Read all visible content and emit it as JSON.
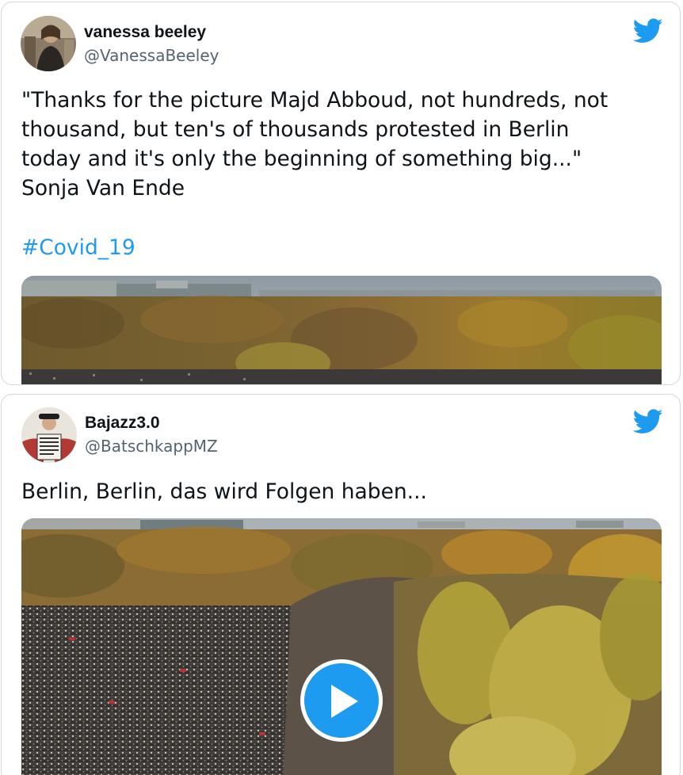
{
  "tweets": [
    {
      "name": "vanessa beeley",
      "handle": "@VanessaBeeley",
      "text_lines": [
        "\"Thanks for the picture Majd Abboud, not hundreds, not",
        "thousand, but ten's of thousands protested in Berlin",
        "today and it's only the beginning of something big...\"",
        "Sonja Van Ende"
      ],
      "hashtag": "#Covid_19",
      "media": {
        "type": "image",
        "icon": "photo"
      }
    },
    {
      "name": "Bajazz3.0",
      "handle": "@BatschkappMZ",
      "text_lines": [
        "Berlin, Berlin, das wird Folgen haben..."
      ],
      "media": {
        "type": "video",
        "icon": "play-icon"
      }
    }
  ],
  "icons": {
    "brand": "twitter-bird-icon"
  },
  "colors": {
    "brand": "#1d9bf0",
    "handle": "#536471",
    "text": "#0f1419",
    "border": "#cfd9de"
  }
}
